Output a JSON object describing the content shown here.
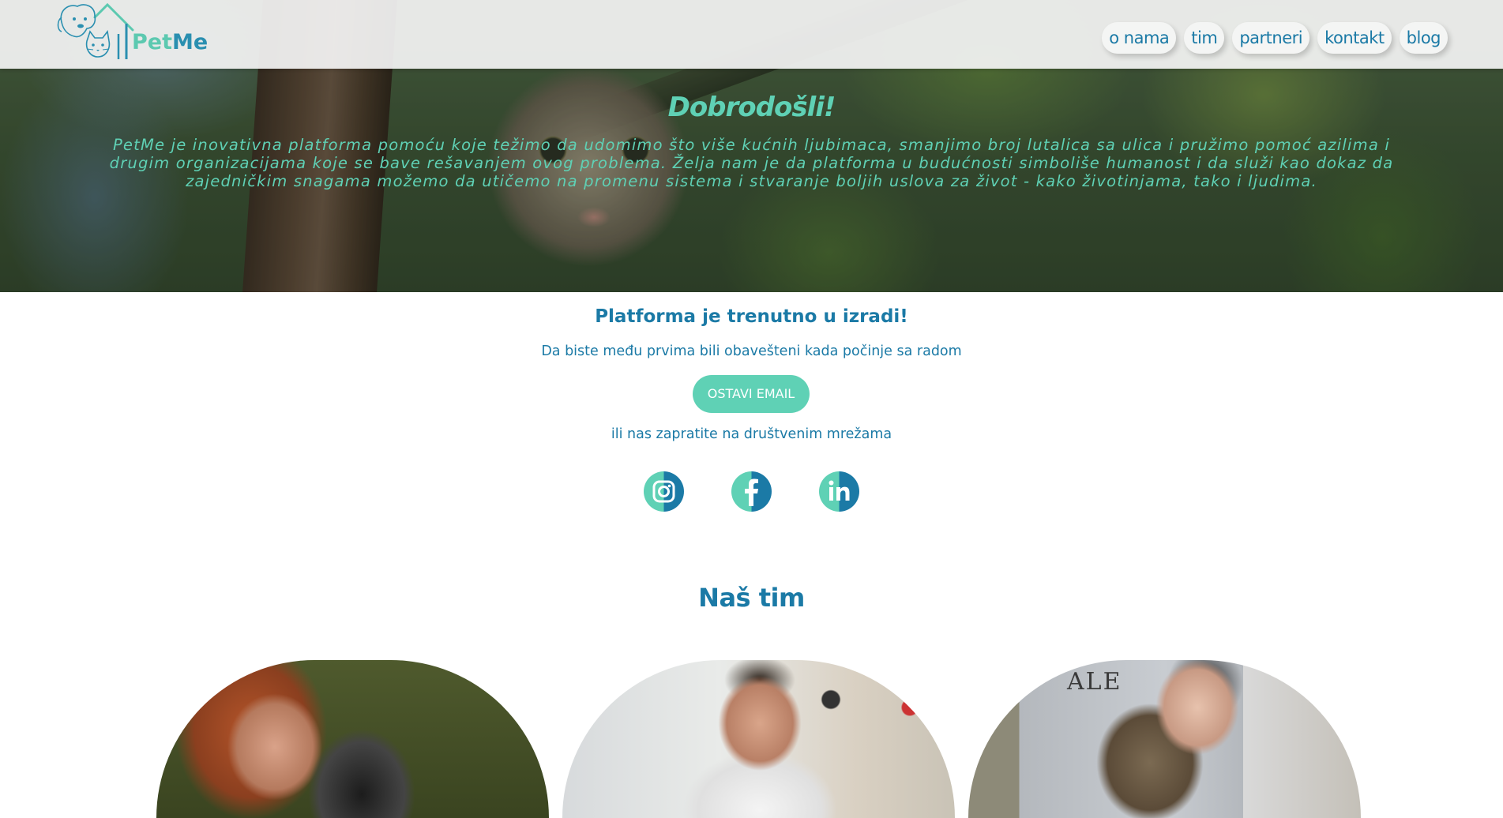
{
  "header": {
    "logo_text_a": "Pet",
    "logo_text_b": "Me",
    "nav": [
      "o nama",
      "tim",
      "partneri",
      "kontakt",
      "blog"
    ]
  },
  "hero": {
    "welcome": "Dobrodošli!",
    "intro": "PetMe je inovativna platforma pomoću koje težimo da udomimo što više kućnih ljubimaca, smanjimo broj lutalica sa ulica i pružimo pomoć azilima i drugim organizacijama koje se bave rešavanjem ovog problema. Želja nam je da platforma u budućnosti simboliše humanost i da služi kao dokaz da zajedničkim snagama možemo da utičemo na promenu sistema i stvaranje boljih uslova za život - kako životinjama, tako i ljudima."
  },
  "main": {
    "title": "Platforma je trenutno u izradi!",
    "subtitle": "Da biste među prvima bili obavešteni kada počinje sa radom",
    "email_button": "OSTAVI EMAIL",
    "social_text": "ili nas zapratite na društvenim mrežama",
    "socials": [
      "instagram-icon",
      "facebook-icon",
      "linkedin-icon"
    ]
  },
  "team": {
    "title": "Naš tim",
    "photo_text": "ALE"
  },
  "colors": {
    "primary": "#1b7aa6",
    "accent": "#5fd1b5",
    "header_bg": "#f5f5f5"
  }
}
